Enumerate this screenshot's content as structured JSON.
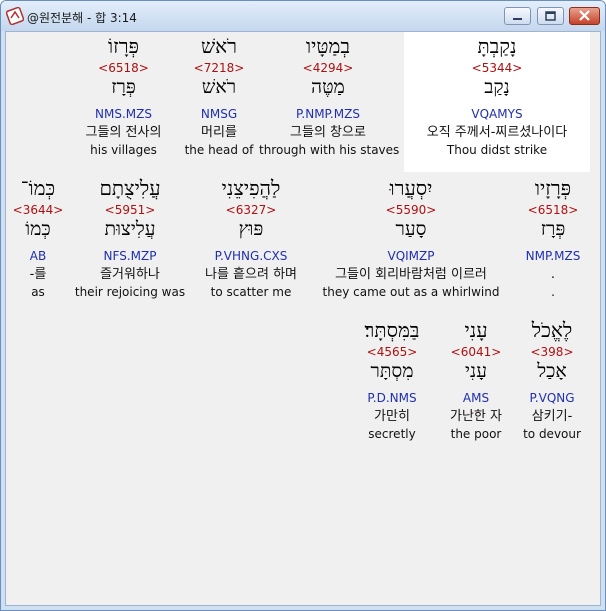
{
  "window": {
    "title": "@원전분해 - 합 3:14"
  },
  "verse_rows": [
    [
      {
        "hebrew": "פְּרָזוֹ",
        "strong": "<6518>",
        "lexeme": "פְּרָז",
        "parse": "NMS.MZS",
        "korean": "그들의 전사의",
        "english": "his villages"
      },
      {
        "hebrew": "רֹאשׁ",
        "strong": "<7218>",
        "lexeme": "רֹאשׁ",
        "parse": "NMSG",
        "korean": "머리를",
        "english": "the head of"
      },
      {
        "hebrew": "בְמַטָּיו",
        "strong": "<4294>",
        "lexeme": "מַטֶּה",
        "parse": "P.NMP.MZS",
        "korean": "그들의 창으로",
        "english": "through with his staves"
      },
      {
        "hebrew": "נָקַבְתָּ",
        "strong": "<5344>",
        "lexeme": "נָקַב",
        "parse": "VQAMYS",
        "korean": "오직 주께서-찌르셨나이다",
        "english": "Thou didst strike"
      }
    ],
    [
      {
        "hebrew": "כְּמוֹ־",
        "strong": "<3644>",
        "lexeme": "כְּמוֹ",
        "parse": "AB",
        "korean": "-를",
        "english": "as"
      },
      {
        "hebrew": "עֲלִיצֻתָם",
        "strong": "<5951>",
        "lexeme": "עֲלִיצוּת",
        "parse": "NFS.MZP",
        "korean": "즐거워하나",
        "english": "their rejoicing was"
      },
      {
        "hebrew": "לַהֲפִיצֵנִי",
        "strong": "<6327>",
        "lexeme": "פּוּץ",
        "parse": "P.VHNG.CXS",
        "korean": "나를 흩으려 하며",
        "english": "to scatter me"
      },
      {
        "hebrew": "יִסְעֲרוּ",
        "strong": "<5590>",
        "lexeme": "סָעַר",
        "parse": "VQIMZP",
        "korean": "그들이 회리바람처럼 이르러",
        "english": "they came out as a whirlwind"
      },
      {
        "hebrew": "פְּרָזָיו",
        "strong": "<6518>",
        "lexeme": "פְּרָז",
        "parse": "NMP.MZS",
        "korean": ".",
        "english": "."
      }
    ],
    [
      {
        "hebrew": "בַּמִּסְתָּר׃",
        "strong": "<4565>",
        "lexeme": "מִסְתָּר",
        "parse": "P.D.NMS",
        "korean": "가만히",
        "english": "secretly"
      },
      {
        "hebrew": "עָנִי",
        "strong": "<6041>",
        "lexeme": "עָנִי",
        "parse": "AMS",
        "korean": "가난한 자",
        "english": "the poor"
      },
      {
        "hebrew": "לֶאֱכֹל",
        "strong": "<398>",
        "lexeme": "אָכַל",
        "parse": "P.VQNG",
        "korean": "삼키기-",
        "english": "to devour"
      }
    ]
  ]
}
